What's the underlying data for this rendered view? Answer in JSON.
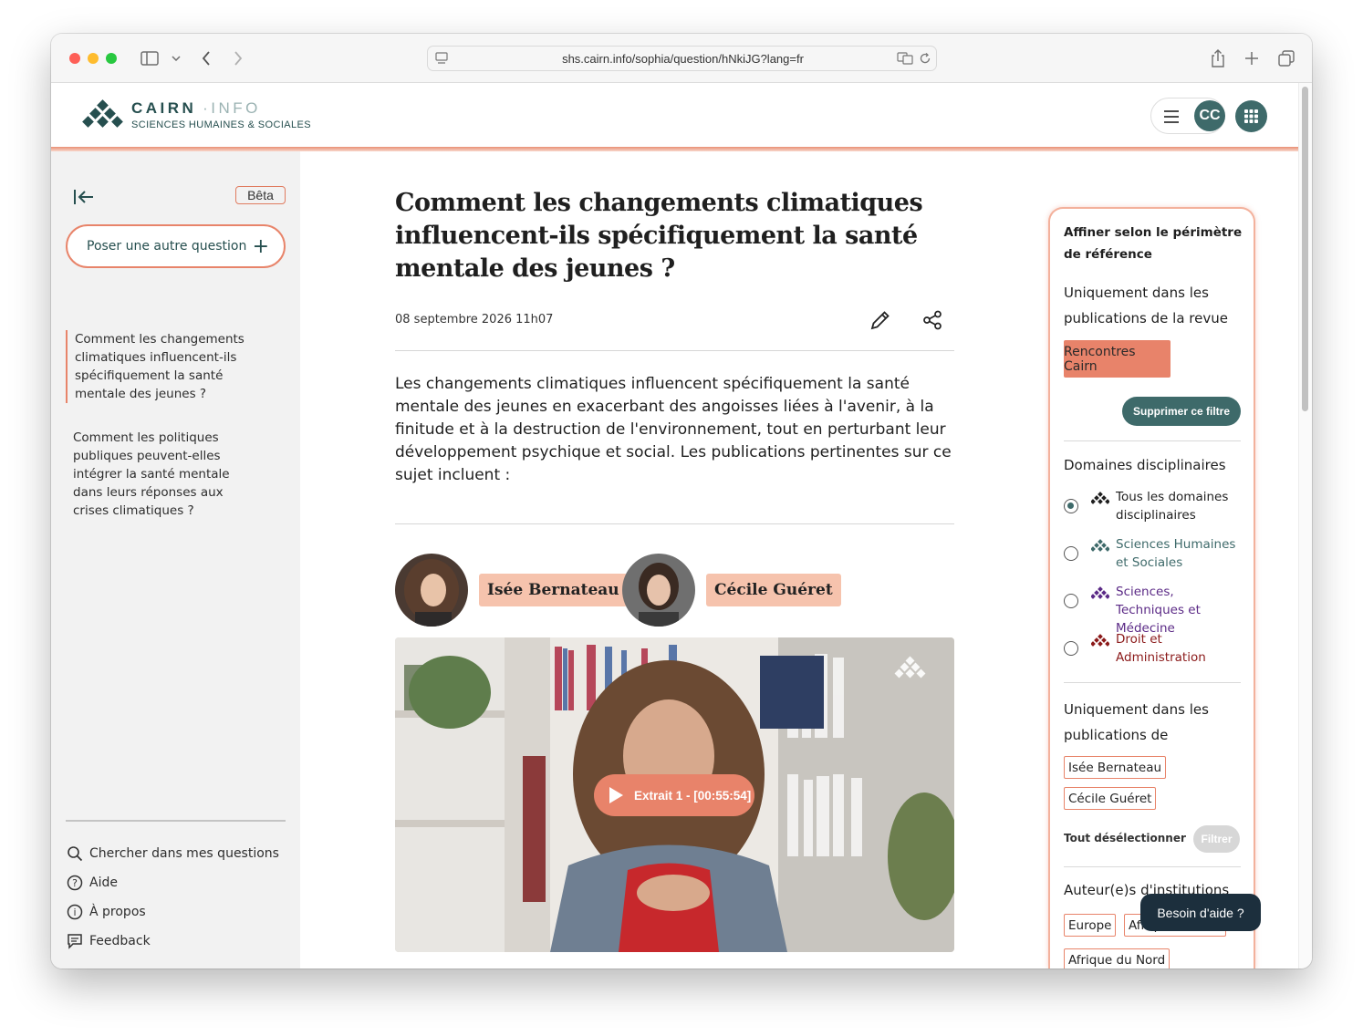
{
  "browser": {
    "url": "shs.cairn.info/sophia/question/hNkiJG?lang=fr"
  },
  "header": {
    "logo_main": "CAIRN",
    "logo_sep": "·",
    "logo_info": "INFO",
    "logo_sub": "SCIENCES HUMAINES & SOCIALES",
    "avatar_initials": "CC",
    "accent_color": "#e8846a",
    "brand_color": "#3e6a6a"
  },
  "sidebar": {
    "beta_label": "Bêta",
    "ask_button": "Poser une autre question",
    "questions": [
      {
        "label": "Comment les changements climatiques influencent-ils spécifiquement la santé mentale des jeunes ?",
        "active": true
      },
      {
        "label": "Comment les politiques publiques peuvent-elles intégrer la santé mentale dans leurs réponses aux crises climatiques ?",
        "active": false
      }
    ],
    "links": [
      {
        "label": "Chercher dans mes questions",
        "icon": "search-icon"
      },
      {
        "label": "Aide",
        "icon": "help-icon"
      },
      {
        "label": "À propos",
        "icon": "info-icon"
      },
      {
        "label": "Feedback",
        "icon": "feedback-icon"
      }
    ]
  },
  "main": {
    "title": "Comment les changements climatiques influencent-ils spécifiquement la santé mentale des jeunes ?",
    "date": "08 septembre 2026 11h07",
    "answer": "Les changements climatiques influencent spécifiquement la santé mentale des jeunes en exacerbant des angoisses liées à l'avenir, à la finitude et à la destruction de l'environnement, tout en perturbant leur développement psychique et social. Les publications pertinentes sur ce sujet incluent :",
    "authors": [
      "Isée Bernateau",
      "Cécile Guéret"
    ],
    "video_button": "Extrait 1 - [00:55:54]"
  },
  "filters": {
    "heading": "Affiner selon le périmètre de référence",
    "revue_heading": "Uniquement dans les publications de la revue",
    "revue_chip": "Rencontres Cairn",
    "remove_filter": "Supprimer ce filtre",
    "domains_heading": "Domaines disciplinaires",
    "domains": [
      {
        "label": "Tous les domaines disciplinaires",
        "color": "#1f1f1f",
        "checked": true
      },
      {
        "label": "Sciences Humaines et Sociales",
        "color": "#3e6a6a",
        "checked": false
      },
      {
        "label": "Sciences, Techniques et Médecine",
        "color": "#5b2a86",
        "checked": false
      },
      {
        "label": "Droit et Administration",
        "color": "#8b1a1a",
        "checked": false
      }
    ],
    "authors_heading": "Uniquement dans les publications de",
    "author_chips": [
      "Isée Bernateau",
      "Cécile Guéret"
    ],
    "deselect_all": "Tout désélectionner",
    "filter_button": "Filtrer",
    "institutions_heading": "Auteur(e)s d'institutions",
    "institution_chips": [
      "Europe",
      "Afrique",
      "Afrique du Nord"
    ]
  },
  "help_button": "Besoin d'aide ?"
}
